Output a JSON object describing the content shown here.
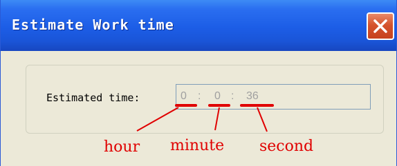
{
  "window": {
    "title": "Estimate Work time"
  },
  "form": {
    "estimated_label": "Estimated time:",
    "time": {
      "hour": "0",
      "minute": "0",
      "second": "36",
      "separator": ":"
    }
  },
  "annotations": {
    "hour": "hour",
    "minute": "minute",
    "second": "second",
    "color": "#e00000"
  },
  "icons": {
    "close": "close-icon"
  }
}
